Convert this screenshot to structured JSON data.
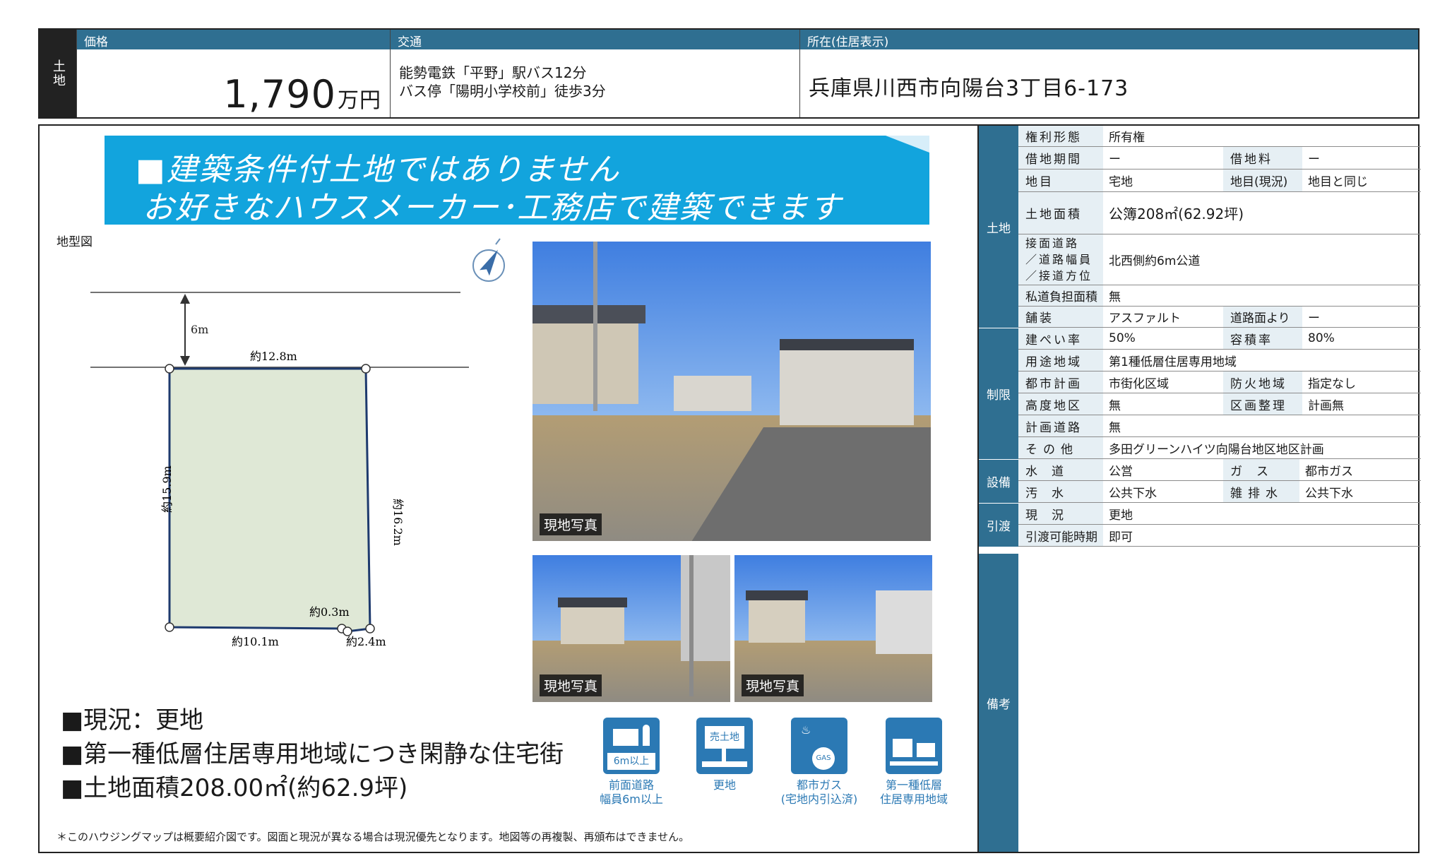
{
  "header": {
    "category": "土地",
    "price_label": "価格",
    "price_value": "1,790",
    "price_unit": "万円",
    "traffic_label": "交通",
    "traffic_line1": "能勢電鉄「平野」駅バス12分",
    "traffic_line2": "バス停「陽明小学校前」徒歩3分",
    "address_label": "所在(住居表示)",
    "address_value": "兵庫県川西市向陽台3丁目6-173"
  },
  "banner": {
    "line1": "■建築条件付土地ではありません",
    "line2": "お好きなハウスメーカー･工務店で建築できます"
  },
  "plan": {
    "label": "地型図",
    "road_width": "6m",
    "top_edge": "約12.8m",
    "left_edge": "約15.9m",
    "right_edge": "約16.2m",
    "bottom_edge": "約10.1m",
    "small_edge": "約0.3m",
    "corner_edge": "約2.4m"
  },
  "photos": {
    "caption_main": "現地写真",
    "caption_left": "現地写真",
    "caption_right": "現地写真"
  },
  "bullets": [
    "■現況：更地",
    "■第一種低層住居専用地域につき閑静な住宅街",
    "■土地面積208.00㎡(約62.9坪)"
  ],
  "icons": [
    {
      "name": "road-icon",
      "inner": "6m以上",
      "label1": "前面道路",
      "label2": "幅員6m以上"
    },
    {
      "name": "vacant-land-icon",
      "inner": "売土地",
      "label1": "更地",
      "label2": ""
    },
    {
      "name": "city-gas-icon",
      "inner": "GAS",
      "label1": "都市ガス",
      "label2": "(宅地内引込済)"
    },
    {
      "name": "residential-zone-icon",
      "inner": "",
      "label1": "第一種低層",
      "label2": "住居専用地域"
    }
  ],
  "footnote": "＊このハウジングマップは概要紹介図です。図面と現況が異なる場合は現況優先となります。地図等の再複製、再頒布はできません。",
  "spec": {
    "bands": {
      "land": "土地",
      "restriction": "制限",
      "facility": "設備",
      "handover": "引渡",
      "remarks": "備考"
    },
    "rows": {
      "rights_k": "権利形態",
      "rights_v": "所有権",
      "lease_period_k": "借地期間",
      "lease_period_v": "ー",
      "lease_fee_k": "借地料",
      "lease_fee_v": "ー",
      "land_type_k": "地目",
      "land_type_v": "宅地",
      "land_type_now_k": "地目(現況)",
      "land_type_now_v": "地目と同じ",
      "area_k": "土地面積",
      "area_v": "公簿208㎡(62.92坪)",
      "road_k1": "接面道路",
      "road_k2": "／道路幅員",
      "road_k3": "／接道方位",
      "road_v": "北西側約6m公道",
      "private_road_k": "私道負担面積",
      "private_road_v": "無",
      "paving_k": "舗装",
      "paving_v": "アスファルト",
      "road_height_k": "道路面より",
      "road_height_v": "ー",
      "bcr_k": "建ぺい率",
      "bcr_v": "50%",
      "far_k": "容積率",
      "far_v": "80%",
      "zoning_k": "用途地域",
      "zoning_v": "第1種低層住居専用地域",
      "city_plan_k": "都市計画",
      "city_plan_v": "市街化区域",
      "fire_k": "防火地域",
      "fire_v": "指定なし",
      "height_k": "高度地区",
      "height_v": "無",
      "readjust_k": "区画整理",
      "readjust_v": "計画無",
      "plan_road_k": "計画道路",
      "plan_road_v": "無",
      "other_k": "その他",
      "other_v": "多田グリーンハイツ向陽台地区地区計画",
      "water_k": "水道",
      "water_v": "公営",
      "gas_k": "ガス",
      "gas_v": "都市ガス",
      "sewage_k": "汚水",
      "sewage_v": "公共下水",
      "drain_k": "雑排水",
      "drain_v": "公共下水",
      "status_k": "現況",
      "status_v": "更地",
      "handover_k": "引渡可能時期",
      "handover_v": "即可"
    }
  }
}
